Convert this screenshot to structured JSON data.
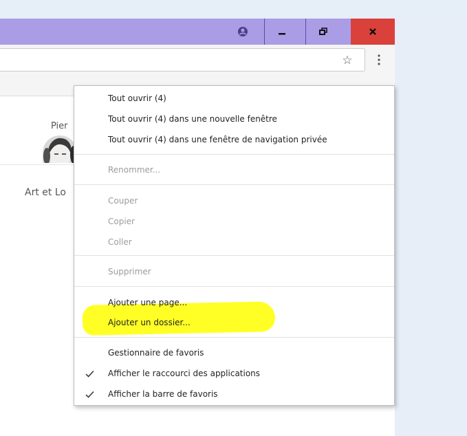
{
  "window": {
    "icons": {
      "profile": "profile-icon",
      "minimize": "minimize-icon",
      "maximize": "restore-icon",
      "close": "close-icon"
    },
    "colors": {
      "titlebar": "#ab9ce6",
      "close_button": "#d9413a"
    }
  },
  "toolbar": {
    "star_glyph": "☆",
    "menu_icon": "vertical-dots-icon"
  },
  "page": {
    "person_name": "Pier",
    "caption": "Art et Lo"
  },
  "context_menu": {
    "open_all": "Tout ouvrir (4)",
    "open_all_new_window": "Tout ouvrir (4) dans une nouvelle fenêtre",
    "open_all_incognito": "Tout ouvrir (4) dans une fenêtre de navigation privée",
    "rename": "Renommer...",
    "cut": "Couper",
    "copy": "Copier",
    "paste": "Coller",
    "delete": "Supprimer",
    "add_page": "Ajouter une page...",
    "add_folder": "Ajouter un dossier...",
    "bookmark_manager": "Gestionnaire de favoris",
    "show_apps_shortcut": "Afficher le raccourci des applications",
    "show_bookmarks_bar": "Afficher la barre de favoris",
    "highlight_color": "#ffff26"
  }
}
